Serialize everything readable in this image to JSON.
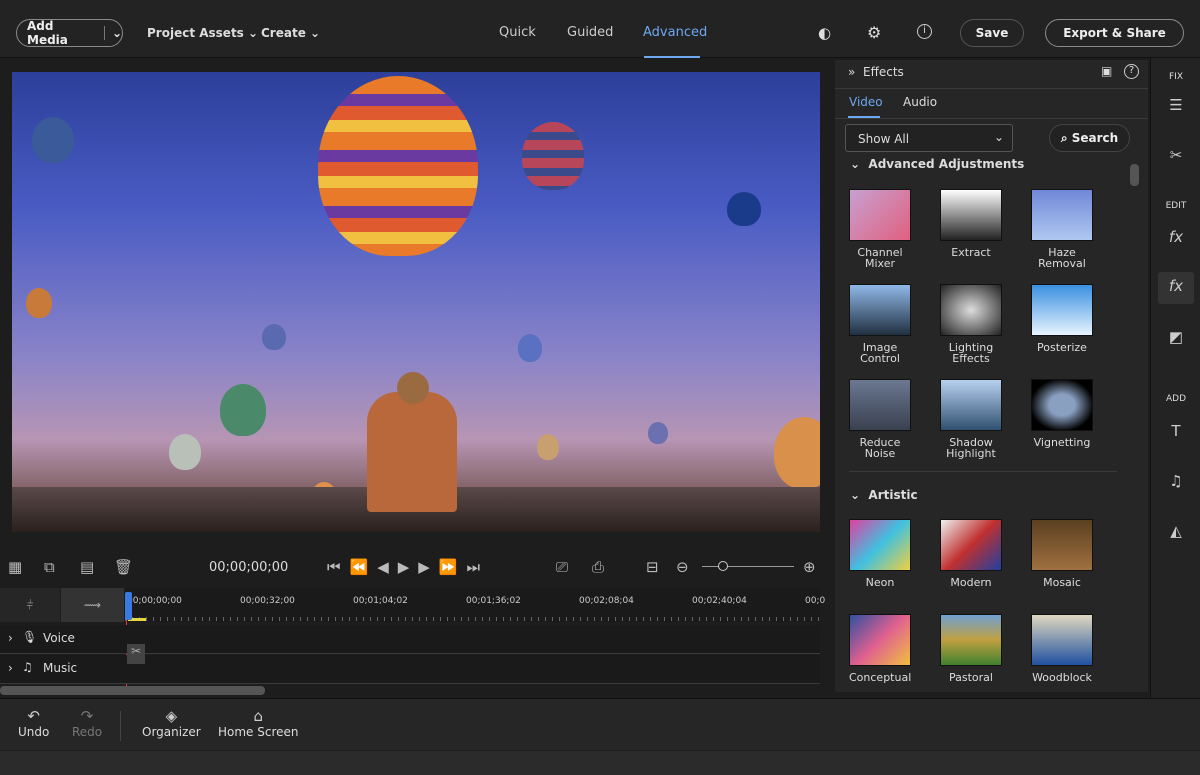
{
  "topbar": {
    "add_media": "Add Media",
    "project_assets": "Project Assets",
    "create": "Create",
    "modes": [
      "Quick",
      "Guided",
      "Advanced"
    ],
    "active_mode": "Advanced",
    "save": "Save",
    "export": "Export & Share"
  },
  "controls": {
    "timecode": "00;00;00;00"
  },
  "timeline": {
    "ticks": [
      "00;00;00;00",
      "00;00;32;00",
      "00;01;04;02",
      "00;01;36;02",
      "00;02;08;04",
      "00;02;40;04",
      "00;0"
    ],
    "tracks": [
      "Voice",
      "Music"
    ]
  },
  "effects": {
    "title": "Effects",
    "tabs": [
      "Video",
      "Audio"
    ],
    "active_tab": "Video",
    "filter": "Show All",
    "search": "Search",
    "sections": [
      {
        "title": "Advanced Adjustments",
        "items": [
          "Channel Mixer",
          "Extract",
          "Haze Removal",
          "Image Control",
          "Lighting Effects",
          "Posterize",
          "Reduce Noise",
          "Shadow Highlight",
          "Vignetting"
        ]
      },
      {
        "title": "Artistic",
        "items": [
          "Neon",
          "Modern",
          "Mosaic",
          "Conceptual",
          "Pastoral",
          "Woodblock"
        ]
      }
    ]
  },
  "righttools": {
    "fix": "FIX",
    "edit": "EDIT",
    "add": "ADD"
  },
  "bottom": {
    "undo": "Undo",
    "redo": "Redo",
    "organizer": "Organizer",
    "home": "Home Screen"
  },
  "colors": {
    "accent": "#6ea8f0",
    "playhead": "#e04040"
  }
}
